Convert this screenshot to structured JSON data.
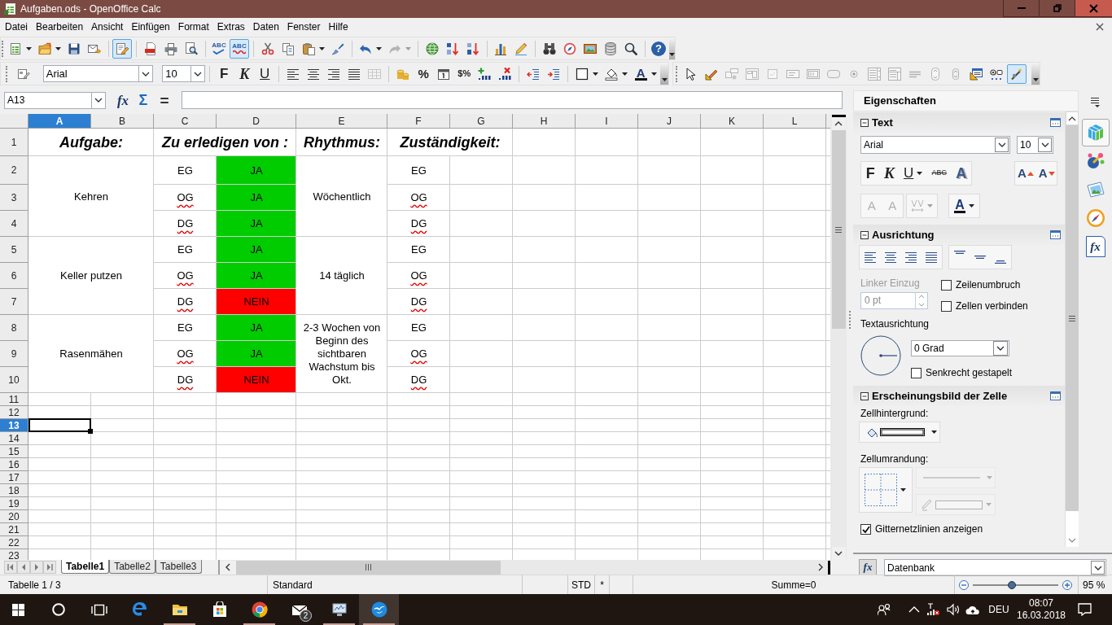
{
  "window": {
    "title": "Aufgaben.ods - OpenOffice Calc"
  },
  "menu": [
    "Datei",
    "Bearbeiten",
    "Ansicht",
    "Einfügen",
    "Format",
    "Extras",
    "Daten",
    "Fenster",
    "Hilfe"
  ],
  "toolbar_rows": [
    {
      "toolbars": [
        {
          "groups": [
            [
              {
                "kind": "new",
                "pressed": false,
                "disabled": false
              },
              {
                "kind": "open",
                "pressed": false,
                "disabled": false
              },
              {
                "kind": "save",
                "pressed": false,
                "disabled": false
              },
              {
                "kind": "email",
                "pressed": false,
                "disabled": false
              }
            ],
            [
              {
                "kind": "edit",
                "pressed": true,
                "disabled": false
              }
            ],
            [
              {
                "kind": "pdf",
                "pressed": false,
                "disabled": false
              },
              {
                "kind": "print",
                "pressed": false,
                "disabled": false
              },
              {
                "kind": "preview",
                "pressed": false,
                "disabled": false
              }
            ],
            [
              {
                "kind": "spelling",
                "label": "ABC",
                "pressed": false,
                "disabled": false
              },
              {
                "kind": "autospell",
                "label": "ABC",
                "pressed": true,
                "disabled": false
              }
            ],
            [
              {
                "kind": "cut",
                "pressed": false,
                "disabled": false
              },
              {
                "kind": "copy",
                "pressed": false,
                "disabled": false
              },
              {
                "kind": "paste",
                "pressed": false,
                "disabled": false
              },
              {
                "kind": "clone",
                "pressed": false,
                "disabled": false
              }
            ],
            [
              {
                "kind": "undo",
                "pressed": false,
                "disabled": false
              },
              {
                "kind": "redo",
                "pressed": false,
                "disabled": true
              }
            ],
            [
              {
                "kind": "hyperlink",
                "pressed": false,
                "disabled": false
              },
              {
                "kind": "sortup",
                "pressed": false,
                "disabled": false
              },
              {
                "kind": "sortdown",
                "pressed": false,
                "disabled": false
              }
            ],
            [
              {
                "kind": "chart",
                "pressed": false,
                "disabled": false
              },
              {
                "kind": "draw",
                "pressed": false,
                "disabled": false
              }
            ],
            [
              {
                "kind": "find",
                "pressed": false,
                "disabled": false
              },
              {
                "kind": "navigator",
                "pressed": false,
                "disabled": false
              },
              {
                "kind": "gallery",
                "pressed": false,
                "disabled": false
              },
              {
                "kind": "datasources",
                "pressed": false,
                "disabled": false
              },
              {
                "kind": "zoom",
                "pressed": false,
                "disabled": false
              }
            ],
            [
              {
                "kind": "help",
                "label": "?",
                "pressed": false,
                "disabled": false
              }
            ]
          ]
        }
      ]
    },
    {
      "toolbars": [
        {
          "groups": [
            [
              {
                "kind": "styles",
                "pressed": false,
                "disabled": false
              },
              {
                "kind": "fontname",
                "value": "Arial",
                "pressed": false,
                "disabled": false
              },
              {
                "kind": "fontsize",
                "value": "10",
                "pressed": false,
                "disabled": false
              }
            ],
            [
              {
                "kind": "bold",
                "label": "F",
                "pressed": false,
                "disabled": false
              },
              {
                "kind": "italic",
                "label": "K",
                "pressed": false,
                "disabled": false
              },
              {
                "kind": "underline",
                "label": "U",
                "pressed": false,
                "disabled": false
              }
            ],
            [
              {
                "kind": "alignleft",
                "pressed": false,
                "disabled": false
              },
              {
                "kind": "aligncenter",
                "pressed": false,
                "disabled": false
              },
              {
                "kind": "alignright",
                "pressed": false,
                "disabled": false
              },
              {
                "kind": "justify",
                "pressed": false,
                "disabled": false
              },
              {
                "kind": "merge",
                "pressed": false,
                "disabled": true
              }
            ],
            [
              {
                "kind": "currency",
                "pressed": false,
                "disabled": false
              },
              {
                "kind": "percent",
                "label": "%",
                "pressed": false,
                "disabled": false
              },
              {
                "kind": "date",
                "pressed": false,
                "disabled": false
              },
              {
                "kind": "standard",
                "label": "$%",
                "pressed": false,
                "disabled": false
              },
              {
                "kind": "adddecimal",
                "pressed": false,
                "disabled": false
              },
              {
                "kind": "deletedecimal",
                "pressed": false,
                "disabled": false
              }
            ],
            [
              {
                "kind": "outdent",
                "pressed": false,
                "disabled": false
              },
              {
                "kind": "indent",
                "pressed": false,
                "disabled": false
              }
            ],
            [
              {
                "kind": "borders",
                "pressed": false,
                "disabled": false
              },
              {
                "kind": "background",
                "pressed": false,
                "disabled": false
              },
              {
                "kind": "fontcolor",
                "label": "A",
                "pressed": false,
                "disabled": false
              }
            ]
          ]
        },
        {
          "groups": [
            [
              {
                "kind": "select",
                "pressed": false,
                "disabled": false
              },
              {
                "kind": "designmode",
                "pressed": false,
                "disabled": false
              },
              {
                "kind": "controlprops",
                "pressed": false,
                "disabled": true
              },
              {
                "kind": "formprops",
                "pressed": false,
                "disabled": true
              },
              {
                "kind": "checkbox",
                "pressed": false,
                "disabled": true
              },
              {
                "kind": "textbox",
                "pressed": false,
                "disabled": true
              },
              {
                "kind": "formatted",
                "pressed": false,
                "disabled": true
              },
              {
                "kind": "pushbutton",
                "pressed": false,
                "disabled": true
              },
              {
                "kind": "optionbutton",
                "pressed": false,
                "disabled": true
              },
              {
                "kind": "listbox",
                "pressed": false,
                "disabled": true
              },
              {
                "kind": "combobox",
                "pressed": false,
                "disabled": true
              },
              {
                "kind": "labelfield",
                "pressed": false,
                "disabled": true
              },
              {
                "kind": "numeric",
                "pressed": false,
                "disabled": true
              },
              {
                "kind": "spin",
                "pressed": false,
                "disabled": true
              },
              {
                "kind": "formdesign",
                "pressed": false,
                "disabled": false
              },
              {
                "kind": "group",
                "pressed": false,
                "disabled": false
              },
              {
                "kind": "wizard",
                "pressed": true,
                "disabled": false
              }
            ]
          ]
        }
      ]
    }
  ],
  "formula_bar": {
    "name_box": "A13",
    "function_wizard": "fx",
    "sum": "Σ",
    "equals": "="
  },
  "sheet": {
    "columns": [
      {
        "label": "A",
        "selected": true
      },
      {
        "label": "B",
        "selected": false
      },
      {
        "label": "C",
        "selected": false
      },
      {
        "label": "D",
        "selected": false
      },
      {
        "label": "E",
        "selected": false
      },
      {
        "label": "F",
        "selected": false
      },
      {
        "label": "G",
        "selected": false
      },
      {
        "label": "H",
        "selected": false
      },
      {
        "label": "I",
        "selected": false
      },
      {
        "label": "J",
        "selected": false
      },
      {
        "label": "K",
        "selected": false
      },
      {
        "label": "L",
        "selected": false
      }
    ],
    "rows": [
      {
        "label": "1",
        "selected": false
      },
      {
        "label": "2",
        "selected": false
      },
      {
        "label": "3",
        "selected": false
      },
      {
        "label": "4",
        "selected": false
      },
      {
        "label": "5",
        "selected": false
      },
      {
        "label": "6",
        "selected": false
      },
      {
        "label": "7",
        "selected": false
      },
      {
        "label": "8",
        "selected": false
      },
      {
        "label": "9",
        "selected": false
      },
      {
        "label": "10",
        "selected": false
      },
      {
        "label": "11",
        "selected": false
      },
      {
        "label": "12",
        "selected": false
      },
      {
        "label": "13",
        "selected": true
      },
      {
        "label": "14",
        "selected": false
      },
      {
        "label": "15",
        "selected": false
      },
      {
        "label": "16",
        "selected": false
      },
      {
        "label": "17",
        "selected": false
      },
      {
        "label": "18",
        "selected": false
      },
      {
        "label": "19",
        "selected": false
      },
      {
        "label": "20",
        "selected": false
      },
      {
        "label": "21",
        "selected": false
      },
      {
        "label": "22",
        "selected": false
      },
      {
        "label": "23",
        "selected": false
      }
    ],
    "headers": [
      "Aufgabe:",
      "Zu erledigen von :",
      "Rhythmus:",
      "Zuständigkeit:"
    ],
    "tasks": [
      {
        "aufgabe": "Kehren",
        "rhythmus": "Wöchentlich",
        "entries": [
          {
            "von": {
              "text": "EG",
              "spell_error": false
            },
            "status": {
              "text": "JA",
              "color": "#00cc00"
            },
            "zustaendigkeit": {
              "text": "EG",
              "spell_error": false
            }
          },
          {
            "von": {
              "text": "OG",
              "spell_error": true
            },
            "status": {
              "text": "JA",
              "color": "#00cc00"
            },
            "zustaendigkeit": {
              "text": "OG",
              "spell_error": true
            }
          },
          {
            "von": {
              "text": "DG",
              "spell_error": true
            },
            "status": {
              "text": "JA",
              "color": "#00cc00"
            },
            "zustaendigkeit": {
              "text": "DG",
              "spell_error": true
            }
          }
        ]
      },
      {
        "aufgabe": "Keller putzen",
        "rhythmus": "14 täglich",
        "entries": [
          {
            "von": {
              "text": "EG",
              "spell_error": false
            },
            "status": {
              "text": "JA",
              "color": "#00cc00"
            },
            "zustaendigkeit": {
              "text": "EG",
              "spell_error": false
            }
          },
          {
            "von": {
              "text": "OG",
              "spell_error": true
            },
            "status": {
              "text": "JA",
              "color": "#00cc00"
            },
            "zustaendigkeit": {
              "text": "OG",
              "spell_error": true
            }
          },
          {
            "von": {
              "text": "DG",
              "spell_error": true
            },
            "status": {
              "text": "NEIN",
              "color": "#ff0000"
            },
            "zustaendigkeit": {
              "text": "DG",
              "spell_error": true
            }
          }
        ]
      },
      {
        "aufgabe": "Rasenmähen",
        "rhythmus": "2-3 Wochen von Beginn des sichtbaren Wachstum bis Okt.",
        "entries": [
          {
            "von": {
              "text": "EG",
              "spell_error": false
            },
            "status": {
              "text": "JA",
              "color": "#00cc00"
            },
            "zustaendigkeit": {
              "text": "EG",
              "spell_error": false
            }
          },
          {
            "von": {
              "text": "OG",
              "spell_error": true
            },
            "status": {
              "text": "JA",
              "color": "#00cc00"
            },
            "zustaendigkeit": {
              "text": "OG",
              "spell_error": true
            }
          },
          {
            "von": {
              "text": "DG",
              "spell_error": true
            },
            "status": {
              "text": "NEIN",
              "color": "#ff0000"
            },
            "zustaendigkeit": {
              "text": "DG",
              "spell_error": true
            }
          }
        ]
      }
    ],
    "tabs": [
      {
        "label": "Tabelle1",
        "selected": true
      },
      {
        "label": "Tabelle2",
        "selected": false
      },
      {
        "label": "Tabelle3",
        "selected": false
      }
    ]
  },
  "sidebar": {
    "title": "Eigenschaften",
    "tabs": [
      {
        "kind": "properties",
        "selected": true
      },
      {
        "kind": "styles",
        "selected": false
      },
      {
        "kind": "gallery",
        "selected": false
      },
      {
        "kind": "navigator",
        "selected": false
      },
      {
        "kind": "functions",
        "label": "fx",
        "selected": false
      }
    ],
    "sections": [
      {
        "kind": "text",
        "title": "Text",
        "expanded": true,
        "font_name": "Arial",
        "font_size": "10",
        "button_groups": [
          [
            {
              "kind": "bold",
              "label": "F",
              "disabled": false
            },
            {
              "kind": "italic",
              "label": "K",
              "disabled": false
            },
            {
              "kind": "underline",
              "label": "U",
              "disabled": false
            },
            {
              "kind": "strikethrough",
              "label": "ABC",
              "disabled": false
            },
            {
              "kind": "shadow",
              "label": "A",
              "disabled": false
            }
          ],
          [
            {
              "kind": "grow",
              "label": "A",
              "disabled": false
            },
            {
              "kind": "shrink",
              "label": "A",
              "disabled": false
            }
          ],
          [
            {
              "kind": "superscript",
              "label": "A",
              "disabled": true
            },
            {
              "kind": "subscript",
              "label": "A",
              "disabled": true
            }
          ],
          [
            {
              "kind": "spacing",
              "disabled": true
            }
          ],
          [
            {
              "kind": "fontcolor",
              "label": "A",
              "disabled": false
            }
          ]
        ]
      },
      {
        "kind": "alignment",
        "title": "Ausrichtung",
        "expanded": true,
        "indent": {
          "label": "Linker Einzug",
          "value": "0 pt",
          "disabled": true
        },
        "checkboxes": [
          {
            "label": "Zeilenumbruch",
            "checked": false
          },
          {
            "label": "Zellen verbinden",
            "checked": false
          }
        ],
        "orientation": {
          "label": "Textausrichtung",
          "value": "0 Grad"
        },
        "stacked": {
          "label": "Senkrecht gestapelt",
          "checked": false
        }
      },
      {
        "kind": "appearance",
        "title": "Erscheinungsbild der Zelle",
        "expanded": true,
        "background_label": "Zellhintergrund:",
        "border_label": "Zellumrandung:",
        "line_style": {
          "disabled": true
        },
        "border_color": {
          "disabled": true
        },
        "gridlines": {
          "label": "Gitternetzlinien anzeigen",
          "checked": true
        }
      }
    ],
    "function_button": "fx",
    "function_category": "Datenbank"
  },
  "status_bar": {
    "sheet": "Tabelle 1 / 3",
    "page_style": "Standard",
    "selection_mode": "STD",
    "modified": "*",
    "sum": "Summe=0",
    "zoom": {
      "level": 0.46,
      "reading": "95 %"
    }
  },
  "taskbar": {
    "apps": [
      {
        "kind": "edge",
        "running": false,
        "selected": false
      },
      {
        "kind": "explorer",
        "running": true,
        "selected": false
      },
      {
        "kind": "store",
        "running": false,
        "selected": false
      },
      {
        "kind": "chrome",
        "running": true,
        "selected": false
      },
      {
        "kind": "mail",
        "badge": "2",
        "running": false,
        "selected": false
      },
      {
        "kind": "monitor",
        "running": true,
        "selected": false
      },
      {
        "kind": "openoffice",
        "running": true,
        "selected": true
      }
    ],
    "language": "DEU",
    "time": "08:07",
    "date": "16.03.2018"
  }
}
